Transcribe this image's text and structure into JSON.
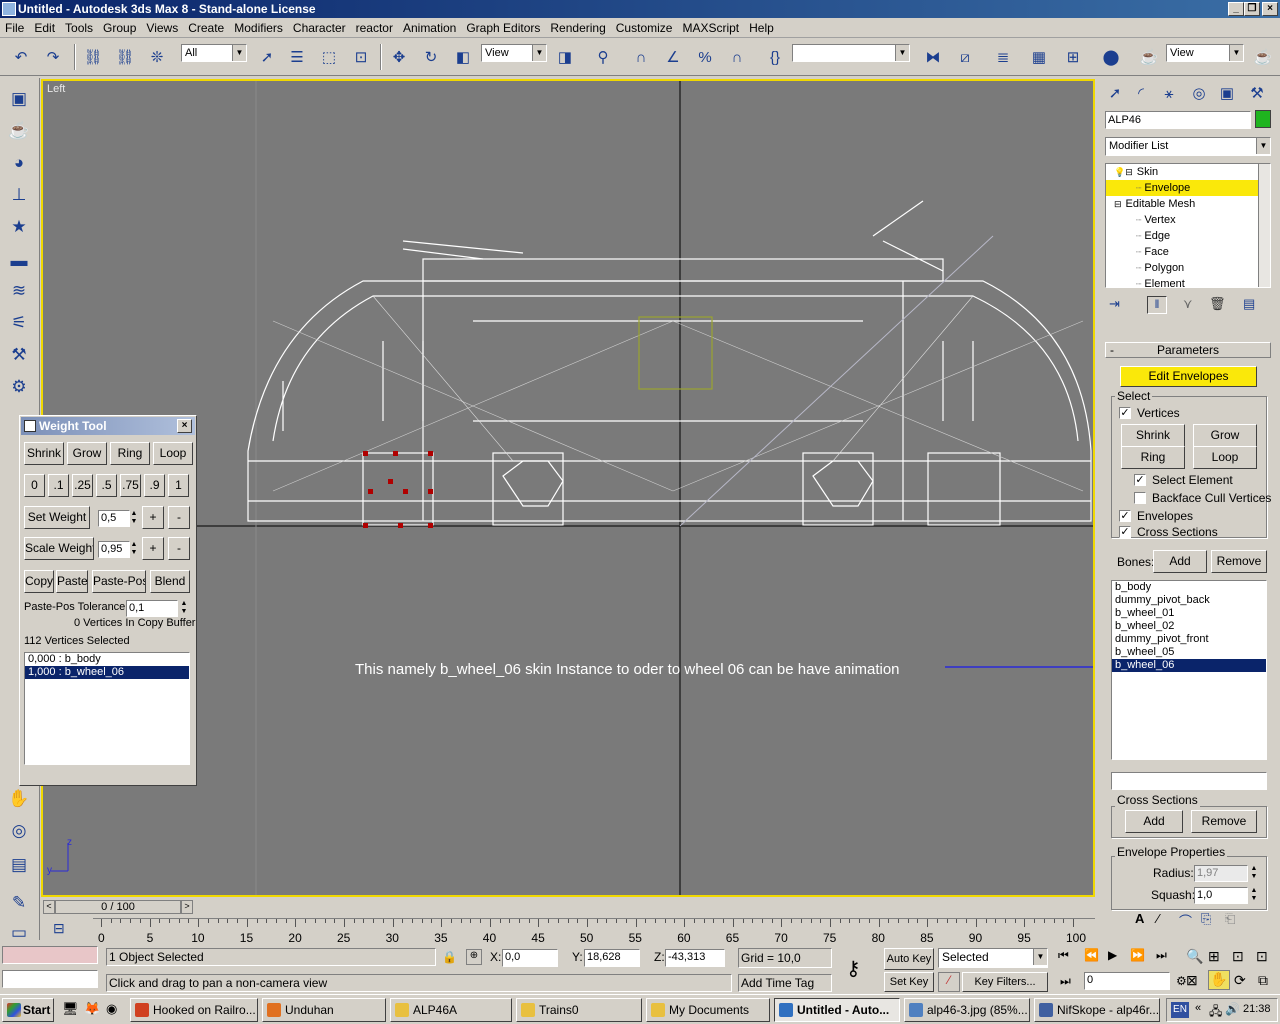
{
  "window": {
    "title": "Untitled - Autodesk 3ds Max 8 - Stand-alone License"
  },
  "menu": [
    "File",
    "Edit",
    "Tools",
    "Group",
    "Views",
    "Create",
    "Modifiers",
    "Character",
    "reactor",
    "Animation",
    "Graph Editors",
    "Rendering",
    "Customize",
    "MAXScript",
    "Help"
  ],
  "toolbar": {
    "filter": "All",
    "ref_coord": "View",
    "named_sel": "",
    "render_view": "View"
  },
  "viewport": {
    "label": "Left",
    "annotation": "This namely b_wheel_06 skin Instance to oder to wheel 06 can be have animation",
    "axis_z": "z",
    "axis_y": "y"
  },
  "weight_tool": {
    "title": "Weight Tool",
    "row1": [
      "Shrink",
      "Grow",
      "Ring",
      "Loop"
    ],
    "presets": [
      "0",
      ".1",
      ".25",
      ".5",
      ".75",
      ".9",
      "1"
    ],
    "set_weight_label": "Set Weight",
    "set_weight_value": "0,5",
    "scale_weight_label": "Scale Weight",
    "scale_weight_value": "0,95",
    "plus": "+",
    "minus": "-",
    "row4": [
      "Copy",
      "Paste",
      "Paste-Pos",
      "Blend"
    ],
    "tolerance_label": "Paste-Pos Tolerance",
    "tolerance_value": "0,1",
    "copy_buffer": "0 Vertices In Copy Buffer",
    "selected_count": "112 Vertices Selected",
    "weights": [
      "0,000 : b_body",
      "1,000 : b_wheel_06"
    ]
  },
  "command_panel": {
    "object_name": "ALP46",
    "object_color": "#1fb41f",
    "modifier_list": "Modifier List",
    "stack": [
      {
        "label": "Skin",
        "level": 0,
        "sel": false,
        "icon": "bulb"
      },
      {
        "label": "Envelope",
        "level": 1,
        "sel": true
      },
      {
        "label": "Editable Mesh",
        "level": 0,
        "sel": false,
        "icon": "none"
      },
      {
        "label": "Vertex",
        "level": 1,
        "sel": false
      },
      {
        "label": "Edge",
        "level": 1,
        "sel": false
      },
      {
        "label": "Face",
        "level": 1,
        "sel": false
      },
      {
        "label": "Polygon",
        "level": 1,
        "sel": false
      },
      {
        "label": "Element",
        "level": 1,
        "sel": false
      }
    ],
    "parameters": {
      "rollout": "Parameters",
      "rollout_toggle": "-",
      "edit_envelopes": "Edit Envelopes",
      "select_group": "Select",
      "vertices": "Vertices",
      "shrink": "Shrink",
      "grow": "Grow",
      "ring": "Ring",
      "loop": "Loop",
      "select_element": "Select Element",
      "backface_cull": "Backface Cull Vertices",
      "envelopes": "Envelopes",
      "cross_sections": "Cross Sections",
      "bones_label": "Bones:",
      "add": "Add",
      "remove": "Remove",
      "bones": [
        "b_body",
        "dummy_pivot_back",
        "b_wheel_01",
        "b_wheel_02",
        "dummy_pivot_front",
        "b_wheel_05",
        "b_wheel_06"
      ],
      "selected_bone": "b_wheel_06",
      "cross_sections_group": "Cross Sections",
      "env_props_group": "Envelope Properties",
      "radius_label": "Radius:",
      "radius_value": "1,97",
      "squash_label": "Squash:",
      "squash_value": "1,0"
    }
  },
  "timeline": {
    "frame": "0 / 100",
    "ticks": [
      0,
      5,
      10,
      15,
      20,
      25,
      30,
      35,
      40,
      45,
      50,
      55,
      60,
      65,
      70,
      75,
      80,
      85,
      90,
      95,
      100
    ]
  },
  "status": {
    "selection": "1 Object Selected",
    "prompt": "Click and drag to pan a non-camera view",
    "x_label": "X:",
    "x": "0,0",
    "y_label": "Y:",
    "y": "18,628",
    "z_label": "Z:",
    "z": "-43,313",
    "grid": "Grid = 10,0",
    "add_time_tag": "Add Time Tag",
    "auto_key": "Auto Key",
    "key_mode": "Selected",
    "set_key": "Set Key",
    "key_filters": "Key Filters...",
    "current_frame": "0"
  },
  "taskbar": {
    "start": "Start",
    "tasks": [
      "Hooked on Railro...",
      "Unduhan",
      "ALP46A",
      "Trains0",
      "My Documents",
      "Untitled - Auto...",
      "alp46-3.jpg (85%...",
      "NifSkope - alp46r..."
    ],
    "lang": "EN",
    "time": "21:38"
  }
}
